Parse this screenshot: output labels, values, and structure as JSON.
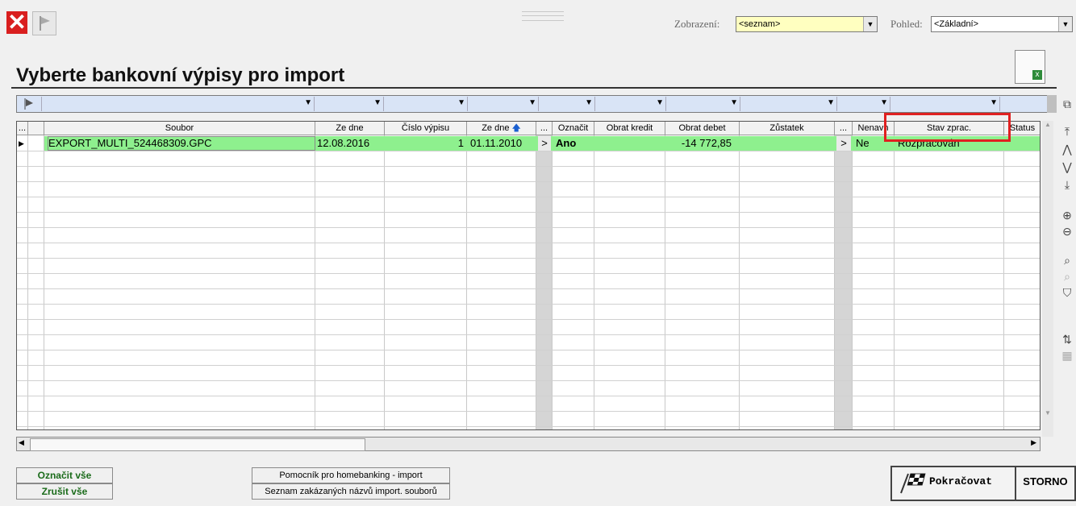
{
  "toolbar": {
    "close_glyph": "✕",
    "zobrazeni_label": "Zobrazení:",
    "zobrazeni_value": "<seznam>",
    "pohled_label": "Pohled:",
    "pohled_value": "<Základní>"
  },
  "page_title": "Vyberte bankovní výpisy pro import",
  "grid": {
    "columns": [
      "...",
      "Soubor",
      "Ze dne",
      "Číslo výpisu",
      "Ze dne",
      "...",
      "Označit",
      "Obrat kredit",
      "Obrat debet",
      "Zůstatek",
      "...",
      "Nenavh",
      "Stav zprac.",
      "Status"
    ],
    "row": {
      "soubor": "EXPORT_MULTI_524468309.GPC",
      "ze_dne": "12.08.2016",
      "cislo_vypisu": "1",
      "ze_dne2": "01.11.2010",
      "arrow1": ">",
      "oznacit": "Ano",
      "obrat_kredit": "",
      "obrat_debet": "-14 772,85",
      "zustatek": "",
      "arrow2": ">",
      "nenavh": "Ne",
      "stav_zprac": "Rozpracován",
      "status": ""
    },
    "highlight_color": "#8ef08e"
  },
  "buttons": {
    "oznacit_vse": "Označit vše",
    "zrusit_vse": "Zrušit vše",
    "pomocnik": "Pomocník pro homebanking - import",
    "seznam": "Seznam zakázaných názvů import. souborů",
    "pokracovat": "Pokračovat",
    "storno": "STORNO"
  },
  "side_icons": [
    "copy-icon",
    "first-record-icon",
    "prev-record-icon",
    "next-record-icon",
    "last-record-icon",
    "zoom-in-icon",
    "zoom-out-icon",
    "find-icon",
    "find-next-icon",
    "filter-icon",
    "sort-az-icon",
    "grid-icon"
  ]
}
